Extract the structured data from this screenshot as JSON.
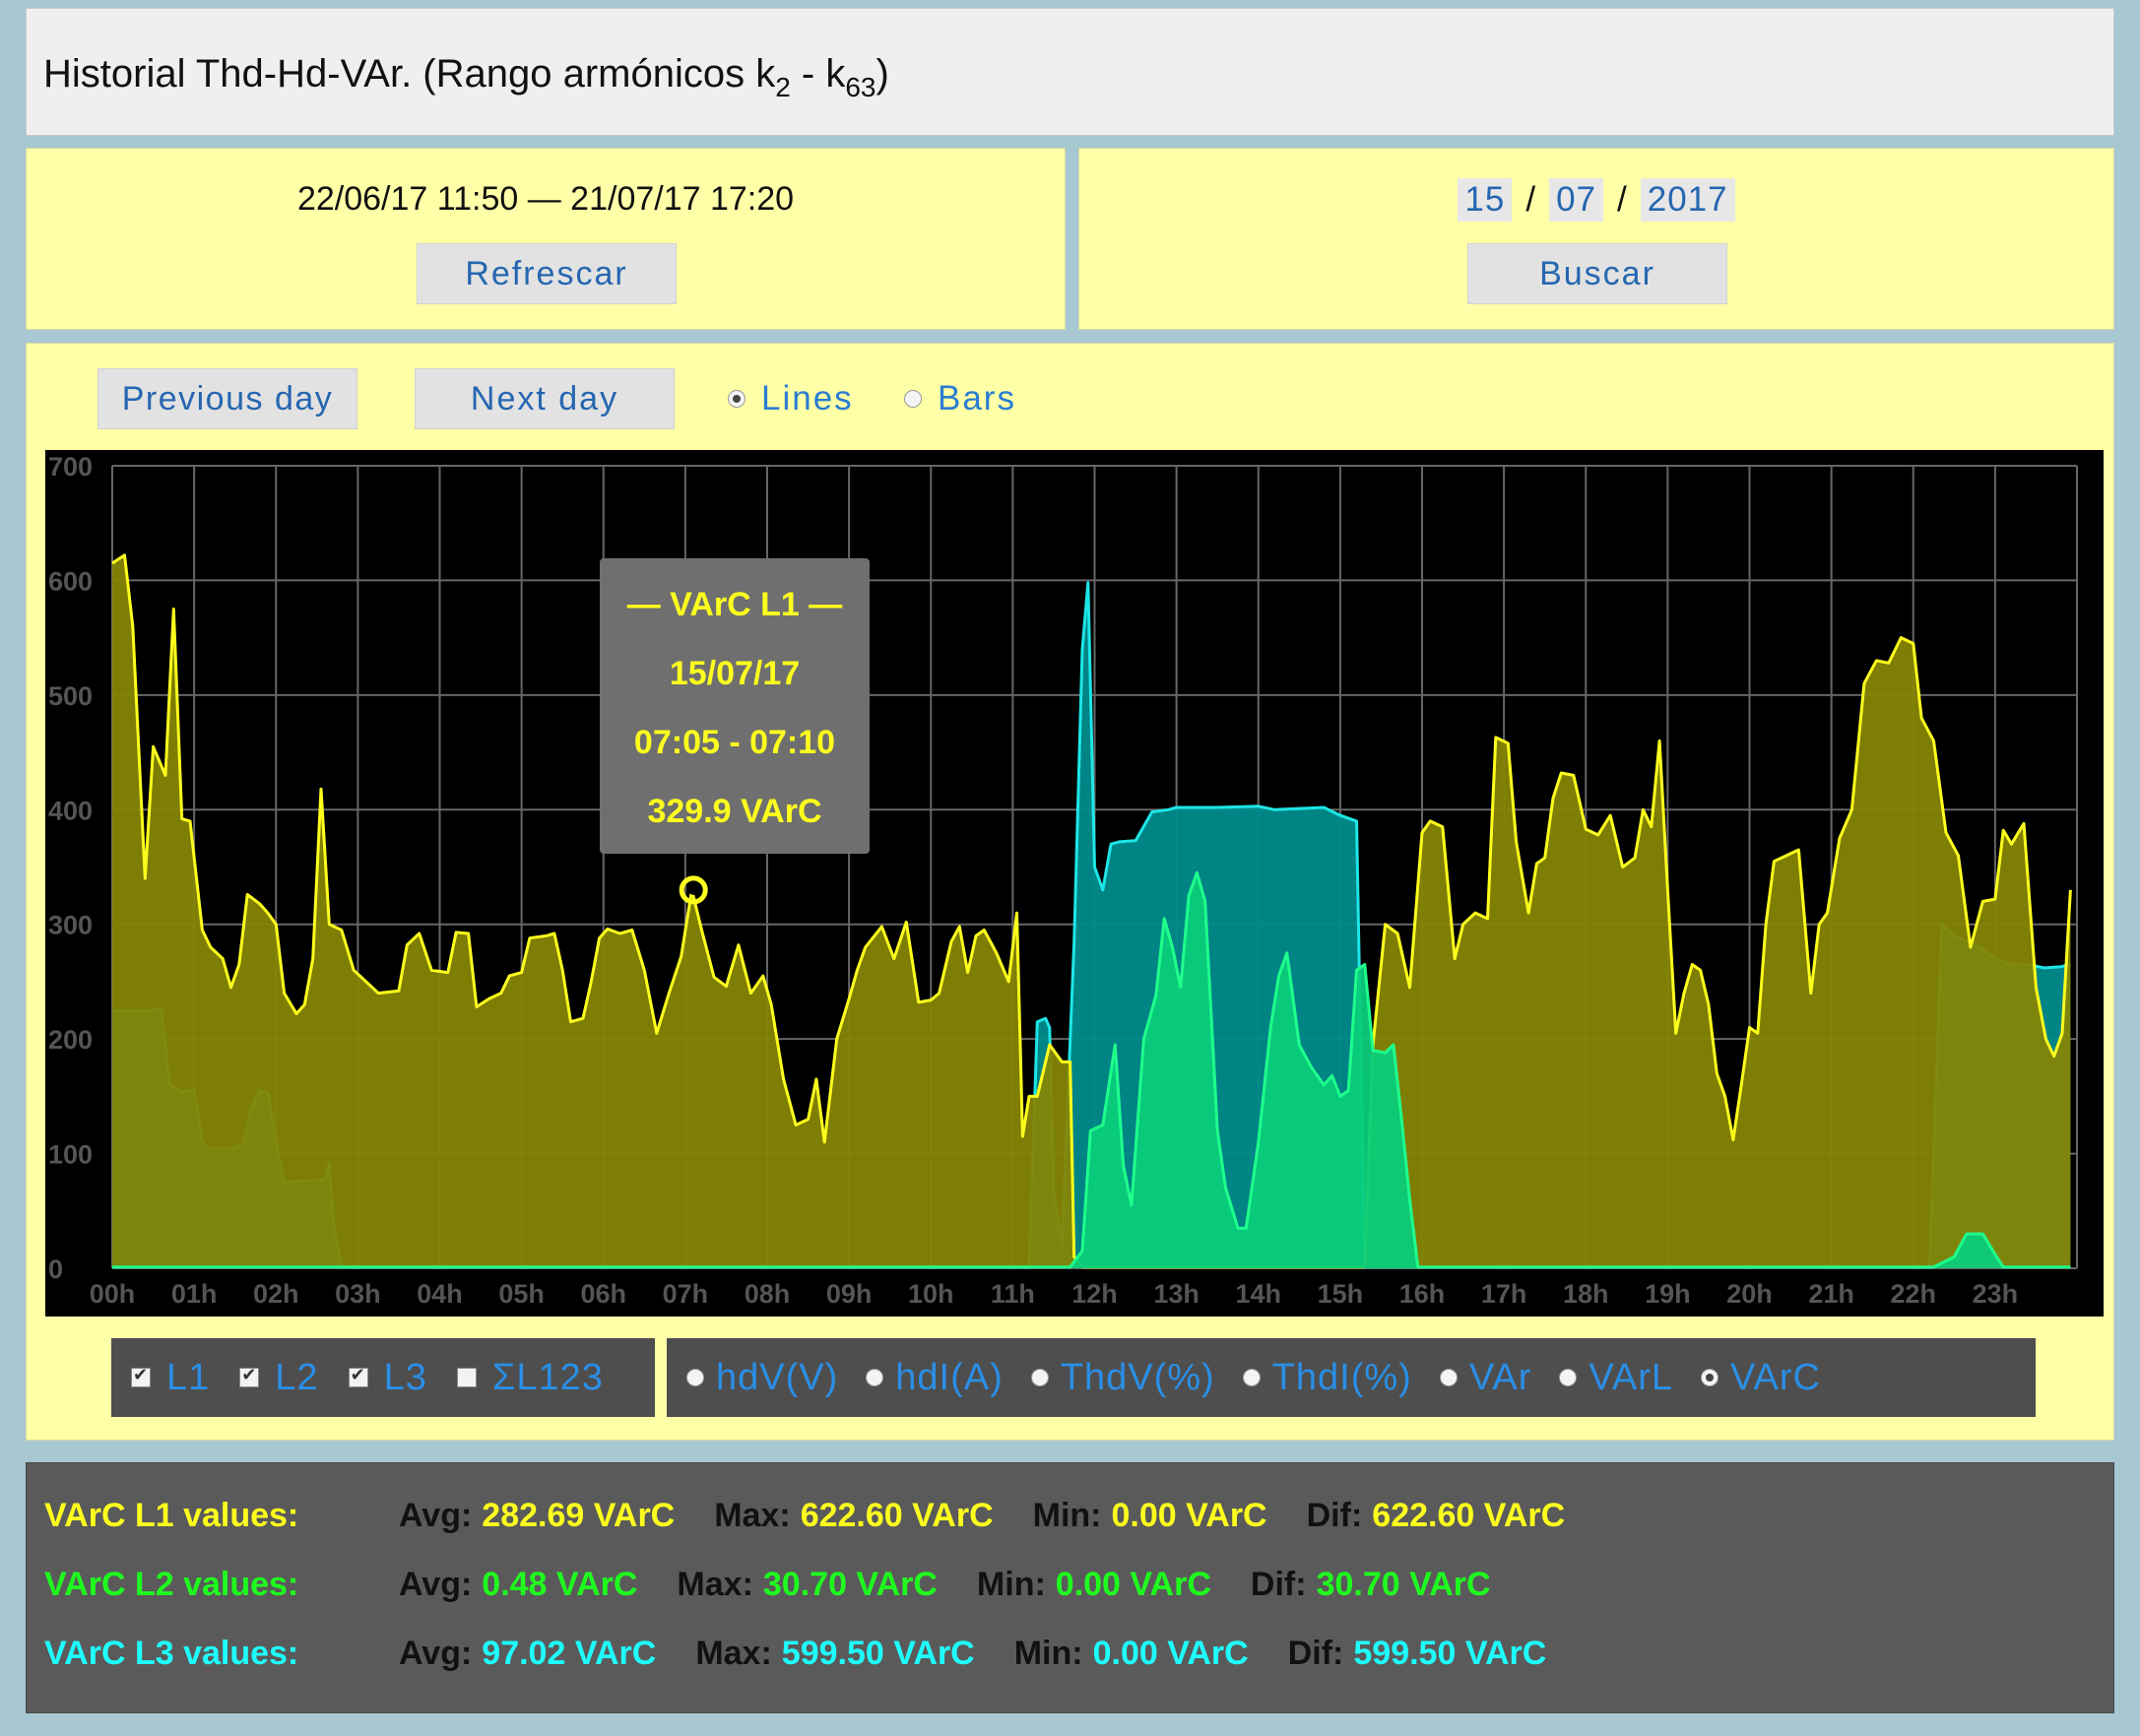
{
  "title": {
    "main": "Historial Thd-Hd-VAr. (Rango armónicos k",
    "sub1": "2",
    "mid": " - k",
    "sub2": "63",
    "end": ")"
  },
  "range": {
    "text": "22/06/17 11:50 — 21/07/17 17:20",
    "refresh_label": "Refrescar"
  },
  "date": {
    "day": "15",
    "month": "07",
    "year": "2017",
    "sep": "/",
    "search_label": "Buscar"
  },
  "nav": {
    "prev_label": "Previous day",
    "next_label": "Next day"
  },
  "mode": {
    "lines_label": "Lines",
    "bars_label": "Bars",
    "selected": "Lines"
  },
  "tooltip": {
    "title": "— VArC L1 —",
    "date": "15/07/17",
    "time": "07:05 - 07:10",
    "value": "329.9 VArC"
  },
  "phases": [
    {
      "label": "L1",
      "checked": true
    },
    {
      "label": "L2",
      "checked": true
    },
    {
      "label": "L3",
      "checked": true
    },
    {
      "label": "ΣL123",
      "checked": false
    }
  ],
  "metrics": [
    {
      "label": "hdV(V)",
      "selected": false
    },
    {
      "label": "hdI(A)",
      "selected": false
    },
    {
      "label": "ThdV(%)",
      "selected": false
    },
    {
      "label": "ThdI(%)",
      "selected": false
    },
    {
      "label": "VAr",
      "selected": false
    },
    {
      "label": "VArL",
      "selected": false
    },
    {
      "label": "VArC",
      "selected": true
    }
  ],
  "stats": [
    {
      "label": "VArC L1 values:",
      "color": "#ffff1e",
      "avg_k": "Avg:",
      "avg": "282.69 VArC",
      "max_k": "Max:",
      "max": "622.60 VArC",
      "min_k": "Min:",
      "min": "0.00 VArC",
      "dif_k": "Dif:",
      "dif": "622.60 VArC"
    },
    {
      "label": "VArC L2 values:",
      "color": "#1eff1e",
      "avg_k": "Avg:",
      "avg": "0.48 VArC",
      "max_k": "Max:",
      "max": "30.70 VArC",
      "min_k": "Min:",
      "min": "0.00 VArC",
      "dif_k": "Dif:",
      "dif": "30.70 VArC"
    },
    {
      "label": "VArC L3 values:",
      "color": "#1effff",
      "avg_k": "Avg:",
      "avg": "97.02 VArC",
      "max_k": "Max:",
      "max": "599.50 VArC",
      "min_k": "Min:",
      "min": "0.00 VArC",
      "dif_k": "Dif:",
      "dif": "599.50 VArC"
    }
  ],
  "chart_data": {
    "type": "area",
    "ylim": [
      0,
      700
    ],
    "yticks": [
      0,
      100,
      200,
      300,
      400,
      500,
      600,
      700
    ],
    "xlim": [
      0,
      24
    ],
    "xticks": [
      "00h",
      "01h",
      "02h",
      "03h",
      "04h",
      "05h",
      "06h",
      "07h",
      "08h",
      "09h",
      "10h",
      "11h",
      "12h",
      "13h",
      "14h",
      "15h",
      "16h",
      "17h",
      "18h",
      "19h",
      "20h",
      "21h",
      "22h",
      "23h"
    ],
    "grid": true,
    "highlight": {
      "series": "L1",
      "x": 7.1,
      "y": 329.9
    },
    "series": [
      {
        "name": "L3",
        "color": "#1ee6e6",
        "fill": "#008b8b",
        "points": [
          [
            0,
            225
          ],
          [
            0.3,
            224
          ],
          [
            0.6,
            226
          ],
          [
            0.7,
            160
          ],
          [
            0.85,
            154
          ],
          [
            1.0,
            155
          ],
          [
            1.1,
            110
          ],
          [
            1.2,
            104
          ],
          [
            1.5,
            105
          ],
          [
            1.6,
            108
          ],
          [
            1.7,
            140
          ],
          [
            1.8,
            155
          ],
          [
            1.9,
            153
          ],
          [
            2.0,
            110
          ],
          [
            2.1,
            75
          ],
          [
            2.3,
            76
          ],
          [
            2.6,
            77
          ],
          [
            2.65,
            92
          ],
          [
            2.7,
            40
          ],
          [
            2.8,
            1
          ],
          [
            11.2,
            1
          ],
          [
            11.3,
            215
          ],
          [
            11.4,
            218
          ],
          [
            11.45,
            210
          ],
          [
            11.5,
            65
          ],
          [
            11.6,
            20
          ],
          [
            11.75,
            285
          ],
          [
            11.85,
            540
          ],
          [
            11.92,
            598
          ],
          [
            12.0,
            350
          ],
          [
            12.1,
            330
          ],
          [
            12.2,
            370
          ],
          [
            12.3,
            372
          ],
          [
            12.5,
            373
          ],
          [
            12.7,
            398
          ],
          [
            12.9,
            400
          ],
          [
            13.0,
            402
          ],
          [
            13.5,
            402
          ],
          [
            14.0,
            403
          ],
          [
            14.2,
            400
          ],
          [
            14.5,
            401
          ],
          [
            14.8,
            402
          ],
          [
            15.0,
            395
          ],
          [
            15.2,
            390
          ],
          [
            15.3,
            1
          ],
          [
            22.2,
            1
          ],
          [
            22.35,
            300
          ],
          [
            22.5,
            290
          ],
          [
            22.8,
            280
          ],
          [
            23.0,
            270
          ],
          [
            23.2,
            265
          ],
          [
            23.4,
            265
          ],
          [
            23.6,
            262
          ],
          [
            23.8,
            263
          ],
          [
            23.92,
            265
          ]
        ]
      },
      {
        "name": "L1",
        "color": "#ffff1e",
        "fill": "#858505",
        "points": [
          [
            0,
            615
          ],
          [
            0.15,
            622
          ],
          [
            0.25,
            560
          ],
          [
            0.4,
            340
          ],
          [
            0.5,
            455
          ],
          [
            0.65,
            430
          ],
          [
            0.75,
            575
          ],
          [
            0.85,
            392
          ],
          [
            0.95,
            390
          ],
          [
            1.1,
            295
          ],
          [
            1.2,
            280
          ],
          [
            1.35,
            270
          ],
          [
            1.45,
            245
          ],
          [
            1.55,
            265
          ],
          [
            1.65,
            326
          ],
          [
            1.8,
            318
          ],
          [
            1.9,
            310
          ],
          [
            2.0,
            300
          ],
          [
            2.1,
            240
          ],
          [
            2.25,
            222
          ],
          [
            2.35,
            230
          ],
          [
            2.45,
            270
          ],
          [
            2.55,
            418
          ],
          [
            2.65,
            300
          ],
          [
            2.8,
            295
          ],
          [
            2.95,
            260
          ],
          [
            3.1,
            250
          ],
          [
            3.25,
            240
          ],
          [
            3.5,
            242
          ],
          [
            3.6,
            282
          ],
          [
            3.75,
            292
          ],
          [
            3.9,
            260
          ],
          [
            4.1,
            258
          ],
          [
            4.2,
            293
          ],
          [
            4.35,
            292
          ],
          [
            4.45,
            228
          ],
          [
            4.6,
            235
          ],
          [
            4.75,
            240
          ],
          [
            4.85,
            255
          ],
          [
            5.0,
            258
          ],
          [
            5.1,
            288
          ],
          [
            5.3,
            290
          ],
          [
            5.4,
            292
          ],
          [
            5.5,
            260
          ],
          [
            5.6,
            215
          ],
          [
            5.75,
            218
          ],
          [
            5.85,
            250
          ],
          [
            5.95,
            288
          ],
          [
            6.05,
            296
          ],
          [
            6.2,
            292
          ],
          [
            6.35,
            295
          ],
          [
            6.5,
            260
          ],
          [
            6.65,
            205
          ],
          [
            6.8,
            240
          ],
          [
            6.95,
            272
          ],
          [
            7.08,
            330
          ],
          [
            7.2,
            295
          ],
          [
            7.35,
            254
          ],
          [
            7.5,
            246
          ],
          [
            7.65,
            282
          ],
          [
            7.8,
            240
          ],
          [
            7.95,
            255
          ],
          [
            8.05,
            230
          ],
          [
            8.2,
            165
          ],
          [
            8.35,
            125
          ],
          [
            8.5,
            130
          ],
          [
            8.6,
            165
          ],
          [
            8.7,
            110
          ],
          [
            8.85,
            200
          ],
          [
            9.0,
            235
          ],
          [
            9.1,
            260
          ],
          [
            9.2,
            280
          ],
          [
            9.4,
            298
          ],
          [
            9.55,
            270
          ],
          [
            9.7,
            302
          ],
          [
            9.85,
            232
          ],
          [
            10.0,
            234
          ],
          [
            10.1,
            240
          ],
          [
            10.25,
            285
          ],
          [
            10.35,
            298
          ],
          [
            10.45,
            258
          ],
          [
            10.55,
            290
          ],
          [
            10.65,
            295
          ],
          [
            10.8,
            275
          ],
          [
            10.95,
            250
          ],
          [
            11.05,
            310
          ],
          [
            11.12,
            115
          ],
          [
            11.2,
            150
          ],
          [
            11.3,
            150
          ],
          [
            11.45,
            195
          ],
          [
            11.6,
            180
          ],
          [
            11.7,
            180
          ],
          [
            11.75,
            10
          ],
          [
            11.85,
            1
          ],
          [
            15.3,
            1
          ],
          [
            15.4,
            195
          ],
          [
            15.55,
            300
          ],
          [
            15.7,
            292
          ],
          [
            15.85,
            245
          ],
          [
            16.0,
            380
          ],
          [
            16.1,
            390
          ],
          [
            16.25,
            385
          ],
          [
            16.4,
            270
          ],
          [
            16.5,
            300
          ],
          [
            16.65,
            310
          ],
          [
            16.8,
            305
          ],
          [
            16.9,
            463
          ],
          [
            17.05,
            458
          ],
          [
            17.15,
            372
          ],
          [
            17.3,
            310
          ],
          [
            17.4,
            353
          ],
          [
            17.5,
            358
          ],
          [
            17.6,
            410
          ],
          [
            17.7,
            432
          ],
          [
            17.85,
            430
          ],
          [
            18.0,
            383
          ],
          [
            18.15,
            378
          ],
          [
            18.3,
            395
          ],
          [
            18.45,
            350
          ],
          [
            18.6,
            358
          ],
          [
            18.7,
            400
          ],
          [
            18.8,
            385
          ],
          [
            18.9,
            460
          ],
          [
            19.0,
            330
          ],
          [
            19.1,
            205
          ],
          [
            19.2,
            240
          ],
          [
            19.3,
            265
          ],
          [
            19.4,
            260
          ],
          [
            19.5,
            230
          ],
          [
            19.6,
            170
          ],
          [
            19.7,
            150
          ],
          [
            19.8,
            112
          ],
          [
            19.9,
            160
          ],
          [
            20.0,
            210
          ],
          [
            20.1,
            205
          ],
          [
            20.2,
            300
          ],
          [
            20.3,
            355
          ],
          [
            20.45,
            360
          ],
          [
            20.6,
            365
          ],
          [
            20.75,
            240
          ],
          [
            20.85,
            300
          ],
          [
            20.95,
            310
          ],
          [
            21.1,
            375
          ],
          [
            21.25,
            400
          ],
          [
            21.4,
            510
          ],
          [
            21.55,
            530
          ],
          [
            21.7,
            528
          ],
          [
            21.85,
            550
          ],
          [
            22.0,
            545
          ],
          [
            22.1,
            480
          ],
          [
            22.25,
            460
          ],
          [
            22.4,
            380
          ],
          [
            22.55,
            360
          ],
          [
            22.7,
            280
          ],
          [
            22.85,
            320
          ],
          [
            23.0,
            322
          ],
          [
            23.1,
            382
          ],
          [
            23.2,
            370
          ],
          [
            23.35,
            388
          ],
          [
            23.5,
            245
          ],
          [
            23.62,
            200
          ],
          [
            23.72,
            185
          ],
          [
            23.82,
            205
          ],
          [
            23.92,
            330
          ]
        ]
      },
      {
        "name": "L2",
        "color": "#1eff8c",
        "fill": "#0acc7a",
        "points": [
          [
            0,
            1
          ],
          [
            11.7,
            1
          ],
          [
            11.85,
            15
          ],
          [
            11.95,
            120
          ],
          [
            12.1,
            125
          ],
          [
            12.25,
            195
          ],
          [
            12.35,
            90
          ],
          [
            12.45,
            55
          ],
          [
            12.6,
            200
          ],
          [
            12.75,
            238
          ],
          [
            12.85,
            305
          ],
          [
            12.95,
            280
          ],
          [
            13.05,
            245
          ],
          [
            13.15,
            325
          ],
          [
            13.25,
            345
          ],
          [
            13.35,
            320
          ],
          [
            13.5,
            120
          ],
          [
            13.6,
            70
          ],
          [
            13.75,
            35
          ],
          [
            13.85,
            35
          ],
          [
            14.0,
            110
          ],
          [
            14.15,
            210
          ],
          [
            14.25,
            255
          ],
          [
            14.35,
            275
          ],
          [
            14.5,
            195
          ],
          [
            14.65,
            175
          ],
          [
            14.8,
            160
          ],
          [
            14.9,
            168
          ],
          [
            15.0,
            150
          ],
          [
            15.1,
            155
          ],
          [
            15.2,
            260
          ],
          [
            15.3,
            265
          ],
          [
            15.4,
            190
          ],
          [
            15.55,
            188
          ],
          [
            15.65,
            195
          ],
          [
            15.75,
            130
          ],
          [
            15.85,
            60
          ],
          [
            15.95,
            1
          ],
          [
            22.25,
            1
          ],
          [
            22.5,
            10
          ],
          [
            22.65,
            30
          ],
          [
            22.85,
            30
          ],
          [
            23.0,
            12
          ],
          [
            23.1,
            1
          ],
          [
            23.92,
            1
          ]
        ]
      }
    ]
  }
}
